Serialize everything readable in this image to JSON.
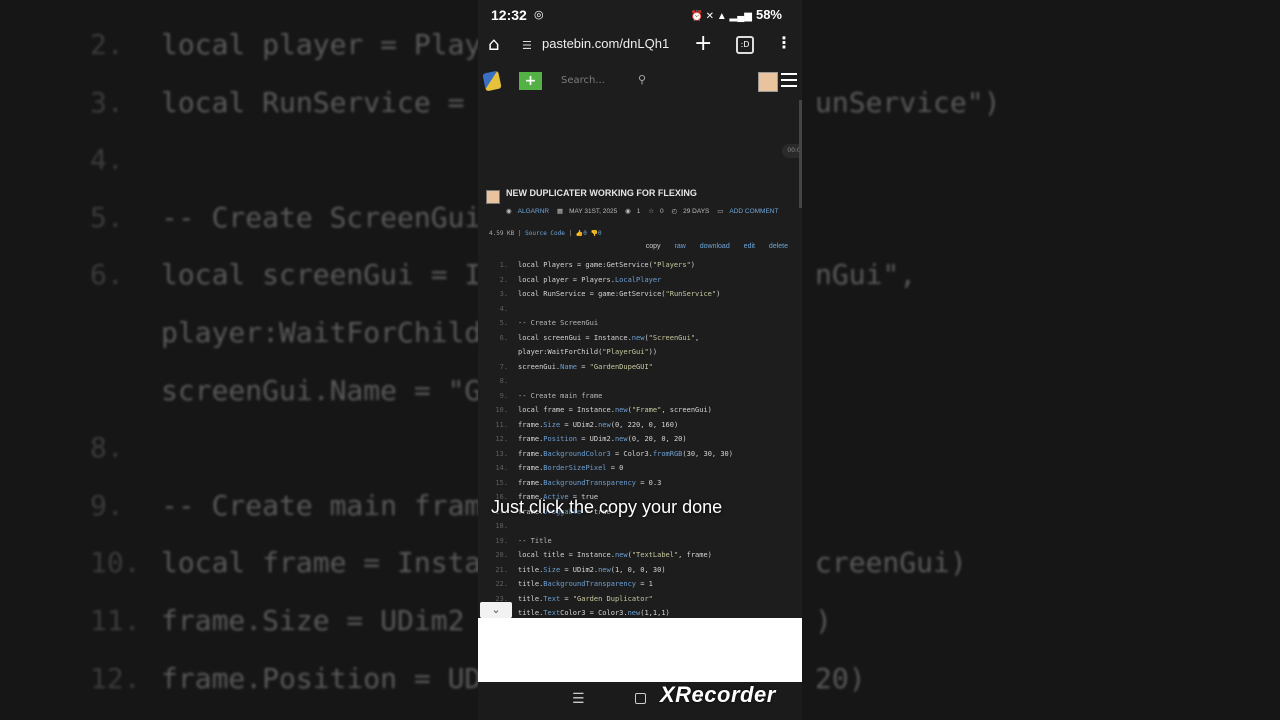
{
  "status_bar": {
    "time": "12:32",
    "indicators": "⏰ ✕ ▲ ▂▄▆",
    "battery": "58%"
  },
  "browser": {
    "url": "pastebin.com/dnLQh1",
    "tabs_count": ":D"
  },
  "site": {
    "search_placeholder": "Search...",
    "new_paste_label": "+"
  },
  "ad_timer": "00:0",
  "paste": {
    "title": "NEW DUPLICATER WORKING FOR FLEXING",
    "author": "ALGARNR",
    "date": "MAY 31ST, 2025",
    "views": "1",
    "stars": "0",
    "expiry": "29 DAYS",
    "add_comment": "ADD COMMENT",
    "size": "4.59 KB",
    "language": "Source Code",
    "likes": "0",
    "dislikes": "0",
    "actions": [
      "copy",
      "raw",
      "download",
      "edit",
      "delete"
    ]
  },
  "code_lines": [
    {
      "n": "1.",
      "text": "local Players = game:GetService(\"Players\")"
    },
    {
      "n": "2.",
      "text": "local player = Players.LocalPlayer"
    },
    {
      "n": "3.",
      "text": "local RunService = game:GetService(\"RunService\")"
    },
    {
      "n": "4.",
      "text": ""
    },
    {
      "n": "5.",
      "text": "-- Create ScreenGui"
    },
    {
      "n": "6.",
      "text": "local screenGui = Instance.new(\"ScreenGui\","
    },
    {
      "n": "",
      "text": "player:WaitForChild(\"PlayerGui\"))"
    },
    {
      "n": "7.",
      "text": "screenGui.Name = \"GardenDupeGUI\""
    },
    {
      "n": "8.",
      "text": ""
    },
    {
      "n": "9.",
      "text": "-- Create main frame"
    },
    {
      "n": "10.",
      "text": "local frame = Instance.new(\"Frame\", screenGui)"
    },
    {
      "n": "11.",
      "text": "frame.Size = UDim2.new(0, 220, 0, 160)"
    },
    {
      "n": "12.",
      "text": "frame.Position = UDim2.new(0, 20, 0, 20)"
    },
    {
      "n": "13.",
      "text": "frame.BackgroundColor3 = Color3.fromRGB(30, 30, 30)"
    },
    {
      "n": "14.",
      "text": "frame.BorderSizePixel = 0"
    },
    {
      "n": "15.",
      "text": "frame.BackgroundTransparency = 0.3"
    },
    {
      "n": "16.",
      "text": "frame.Active = true"
    },
    {
      "n": "17.",
      "text": "frame.Draggable = true"
    },
    {
      "n": "18.",
      "text": ""
    },
    {
      "n": "19.",
      "text": "-- Title"
    },
    {
      "n": "20.",
      "text": "local title = Instance.new(\"TextLabel\", frame)"
    },
    {
      "n": "21.",
      "text": "title.Size = UDim2.new(1, 0, 0, 30)"
    },
    {
      "n": "22.",
      "text": "title.BackgroundTransparency = 1"
    },
    {
      "n": "23.",
      "text": "title.Text = \"Garden Duplicator\""
    },
    {
      "n": "24.",
      "text": "title.TextColor3 = Color3.new(1,1,1)"
    }
  ],
  "background_zoom": [
    {
      "n": "2.",
      "text": "local player = Play"
    },
    {
      "n": "3.",
      "text": "local RunService = ",
      "tail": "unService\")"
    },
    {
      "n": "4.",
      "text": ""
    },
    {
      "n": "5.",
      "text": "-- Create ScreenGui"
    },
    {
      "n": "6.",
      "text": "local screenGui = I",
      "tail": "nGui\","
    },
    {
      "n": "",
      "text": "player:WaitForChild"
    },
    {
      "n": "",
      "text": "screenGui.Name = \"G"
    },
    {
      "n": "8.",
      "text": ""
    },
    {
      "n": "9.",
      "text": "-- Create main fram"
    },
    {
      "n": "10.",
      "text": "local frame = Insta",
      "tail": "creenGui)"
    },
    {
      "n": "11.",
      "text": "frame.Size = UDim2",
      "tail": ")"
    },
    {
      "n": "12.",
      "text": "frame.Position = UD",
      "tail": "20)"
    }
  ],
  "caption": "Just click the copy your done",
  "watermark": "XRecorder"
}
